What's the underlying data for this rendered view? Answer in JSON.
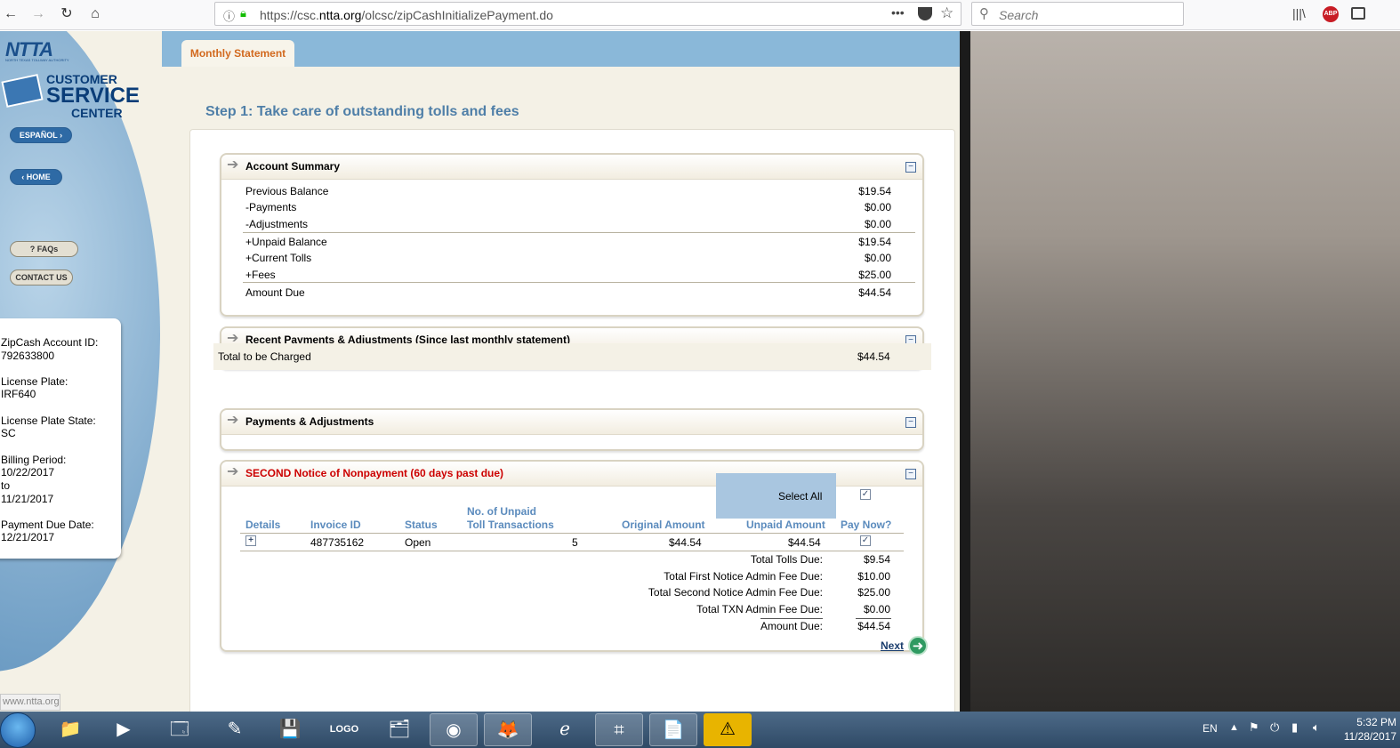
{
  "browser": {
    "url_prefix": "https://csc.",
    "url_domain": "ntta.org",
    "url_path": "/olcsc/zipCashInitializePayment.do",
    "search_placeholder": "Search",
    "more_glyph": "•••",
    "abp_label": "ABP"
  },
  "sidebar": {
    "logo": "NTTA",
    "logo_sub": "NORTH TEXAS TOLLWAY AUTHORITY",
    "csc_line1": "CUSTOMER",
    "csc_line2": "SERVICE",
    "csc_line3": "CENTER",
    "espanol": "ESPAÑOL ›",
    "home": "‹ HOME",
    "faqs": "? FAQs",
    "contact": "CONTACT US",
    "account": {
      "id_label": "ZipCash Account ID:",
      "id_value": "792633800",
      "plate_label": "License Plate:",
      "plate_value": "IRF640",
      "state_label": "License Plate State:",
      "state_value": "SC",
      "period_label": "Billing Period:",
      "period_from": "10/22/2017",
      "period_to_word": "to",
      "period_to": "11/21/2017",
      "due_label": "Payment Due Date:",
      "due_value": "12/21/2017"
    }
  },
  "tabs": {
    "monthly": "Monthly Statement"
  },
  "step_title": "Step 1: Take care of outstanding tolls and fees",
  "account_summary": {
    "title": "Account Summary",
    "rows": [
      {
        "label": "Previous Balance",
        "value": "$19.54"
      },
      {
        "label": "-Payments",
        "value": "$0.00"
      },
      {
        "label": "-Adjustments",
        "value": "$0.00"
      },
      {
        "label": "+Unpaid Balance",
        "value": "$19.54"
      },
      {
        "label": "+Current Tolls",
        "value": "$0.00"
      },
      {
        "label": "+Fees",
        "value": "$25.00"
      },
      {
        "label": "Amount Due",
        "value": "$44.54"
      }
    ]
  },
  "recent_payments": {
    "title": "Recent Payments & Adjustments (Since last monthly statement)"
  },
  "total_charged": {
    "label": "Total to be Charged",
    "value": "$44.54"
  },
  "payments_adjustments": {
    "title": "Payments & Adjustments"
  },
  "notice": {
    "title": "SECOND Notice of Nonpayment (60 days past due)",
    "select_all": "Select All",
    "headers": {
      "details": "Details",
      "invoice": "Invoice ID",
      "status": "Status",
      "unpaid_tx_1": "No. of Unpaid",
      "unpaid_tx_2": "Toll Transactions",
      "original": "Original Amount",
      "unpaid": "Unpaid Amount",
      "pay_now": "Pay Now?"
    },
    "row": {
      "expand": "+",
      "invoice": "487735162",
      "status": "Open",
      "unpaid_tx": "5",
      "original": "$44.54",
      "unpaid": "$44.54"
    },
    "totals": [
      {
        "label": "Total Tolls Due:",
        "value": "$9.54"
      },
      {
        "label": "Total First Notice Admin Fee Due:",
        "value": "$10.00"
      },
      {
        "label": "Total Second Notice Admin Fee Due:",
        "value": "$25.00"
      },
      {
        "label": "Total TXN Admin Fee Due:",
        "value": "$0.00"
      },
      {
        "label": "Amount Due:",
        "value": "$44.54"
      }
    ]
  },
  "next": "Next",
  "status_url": "www.ntta.org",
  "taskbar": {
    "lang": "EN",
    "time": "5:32 PM",
    "date": "11/28/2017"
  },
  "colors": {
    "accent": "#4f7fa8",
    "notice_red": "#cc0000",
    "tab_orange": "#d2691e",
    "header_blue": "#5b8bbd"
  }
}
